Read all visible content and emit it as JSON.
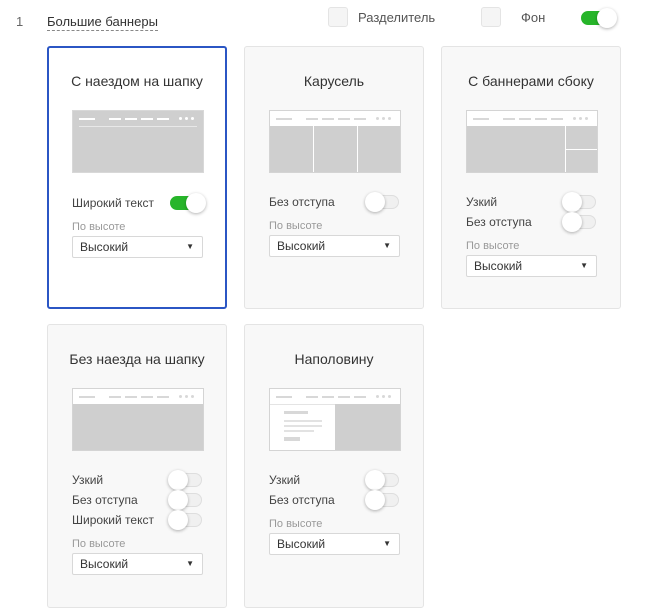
{
  "section": {
    "number": "1",
    "title": "Большие баннеры"
  },
  "options": {
    "divider_label": "Разделитель",
    "divider_checked": false,
    "background_label": "Фон",
    "background_checked": false,
    "section_enabled": true
  },
  "cards": [
    {
      "title": "С наездом на шапку",
      "selected": true,
      "wide_text_label": "Широкий текст",
      "wide_text_on": true,
      "height_label": "По высоте",
      "height_value": "Высокий"
    },
    {
      "title": "Карусель",
      "no_margin_label": "Без отступа",
      "no_margin_on": false,
      "height_label": "По высоте",
      "height_value": "Высокий"
    },
    {
      "title": "С баннерами сбоку",
      "narrow_label": "Узкий",
      "no_margin_label": "Без отступа",
      "height_label": "По высоте",
      "height_value": "Высокий"
    },
    {
      "title": "Без наезда на шапку",
      "narrow_label": "Узкий",
      "no_margin_label": "Без отступа",
      "wide_text_label": "Широкий текст",
      "height_label": "По высоте",
      "height_value": "Высокий"
    },
    {
      "title": "Наполовину",
      "narrow_label": "Узкий",
      "no_margin_label": "Без отступа",
      "height_label": "По высоте",
      "height_value": "Высокий"
    }
  ],
  "select_arrow": "▼",
  "colors": {
    "accent": "#2b56c4",
    "toggle_on": "#27b52a"
  }
}
